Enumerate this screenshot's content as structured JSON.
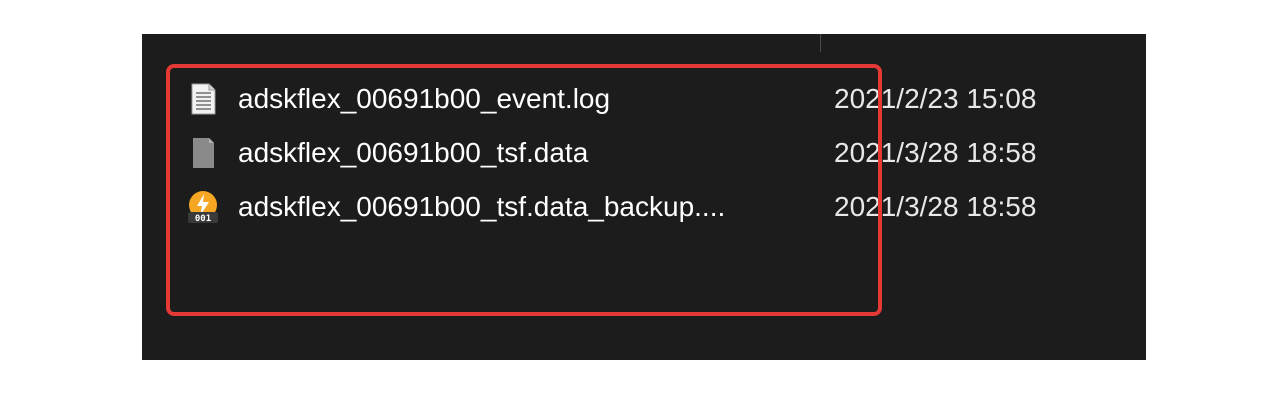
{
  "files": [
    {
      "name": "adskflex_00691b00_event.log",
      "date": "2021/2/23 15:08",
      "icon": "text-document-icon"
    },
    {
      "name": "adskflex_00691b00_tsf.data",
      "date": "2021/3/28 18:58",
      "icon": "generic-file-icon"
    },
    {
      "name": "adskflex_00691b00_tsf.data_backup....",
      "date": "2021/3/28 18:58",
      "icon": "backup-file-icon"
    }
  ],
  "backup_icon_label": "001",
  "colors": {
    "panel": "#1c1c1c",
    "highlight": "#e53935",
    "backup_icon_orange": "#f5a623"
  }
}
